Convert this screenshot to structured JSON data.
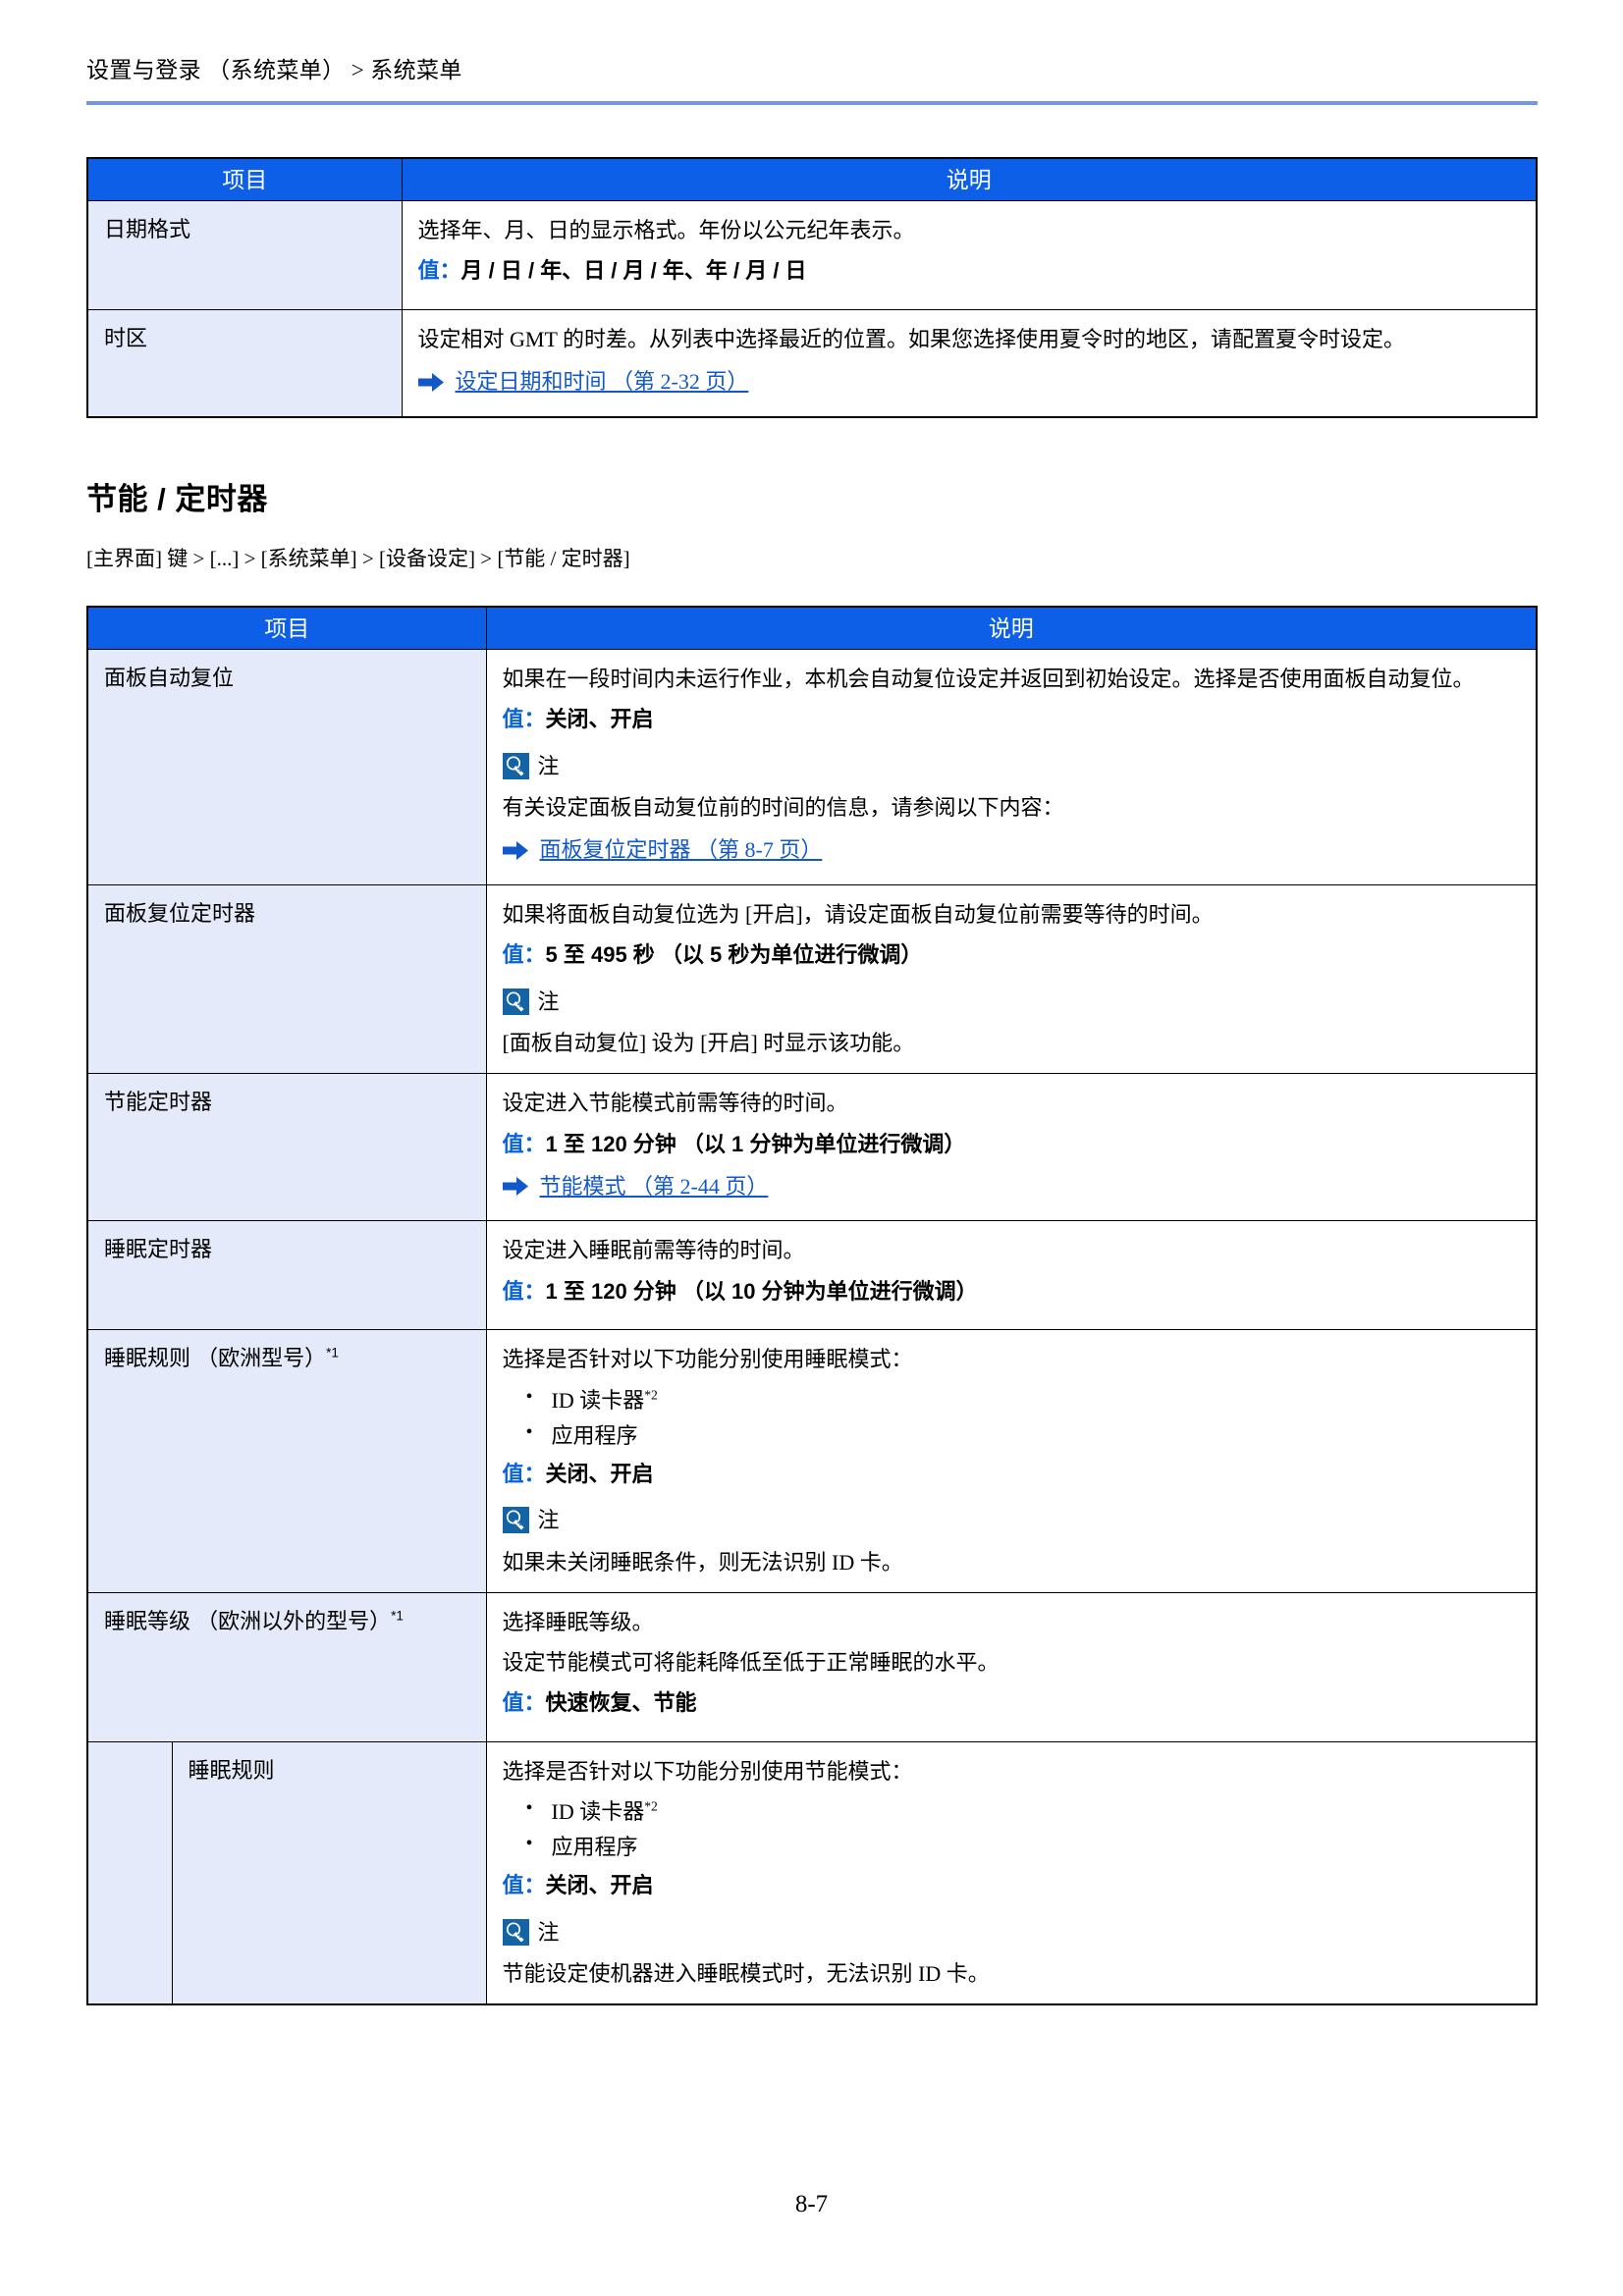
{
  "header": {
    "breadcrumb": "设置与登录 （系统菜单） > 系统菜单"
  },
  "footer": {
    "page_number": "8-7"
  },
  "table_date_time": {
    "columns": [
      "项目",
      "说明"
    ],
    "rows": [
      {
        "item": "日期格式",
        "desc_lines": [
          "选择年、月、日的显示格式。年份以公元纪年表示。"
        ],
        "value_key": "值：",
        "value_rest": "月 / 日 / 年、日 / 月 / 年、年 / 月 / 日"
      },
      {
        "item": "时区",
        "desc_lines": [
          "设定相对 GMT 的时差。从列表中选择最近的位置。如果您选择使用夏令时的地区，请配置夏令时设定。"
        ],
        "xref": "设定日期和时间 （第 2-32 页）"
      }
    ]
  },
  "section_energy": {
    "title": "节能 / 定时器",
    "path": "[主界面] 键 > [...] > [系统菜单] > [设备设定] > [节能 / 定时器]",
    "columns": [
      "项目",
      "说明"
    ],
    "rows": [
      {
        "item": "面板自动复位",
        "desc_lines": [
          "如果在一段时间内未运行作业，本机会自动复位设定并返回到初始设定。选择是否使用面板自动复位。"
        ],
        "value_key": "值：",
        "value_rest": "关闭、开启",
        "note_label": "注",
        "note_text": "有关设定面板自动复位前的时间的信息，请参阅以下内容：",
        "xref": "面板复位定时器 （第 8-7 页）"
      },
      {
        "item": "面板复位定时器",
        "desc_lines": [
          "如果将面板自动复位选为 [开启]，请设定面板自动复位前需要等待的时间。"
        ],
        "value_key": "值：",
        "value_rest": "5 至 495 秒 （以 5 秒为单位进行微调）",
        "note_label": "注",
        "note_text": "[面板自动复位] 设为 [开启] 时显示该功能。"
      },
      {
        "item": "节能定时器",
        "desc_lines": [
          "设定进入节能模式前需等待的时间。"
        ],
        "value_key": "值：",
        "value_rest": "1 至 120 分钟 （以 1 分钟为单位进行微调）",
        "xref": "节能模式 （第 2-44 页）"
      },
      {
        "item": "睡眠定时器",
        "desc_lines": [
          "设定进入睡眠前需等待的时间。"
        ],
        "value_key": "值：",
        "value_rest": "1 至 120 分钟 （以 10 分钟为单位进行微调）"
      },
      {
        "item": "睡眠规则 （欧洲型号）",
        "item_footnote": "*1",
        "desc_lines": [
          "选择是否针对以下功能分别使用睡眠模式："
        ],
        "bullets": [
          {
            "text": "ID 读卡器",
            "footnote": "*2"
          },
          {
            "text": "应用程序",
            "footnote": ""
          }
        ],
        "value_key": "值：",
        "value_rest": "关闭、开启",
        "note_label": "注",
        "note_text": "如果未关闭睡眠条件，则无法识别 ID 卡。"
      },
      {
        "item": "睡眠等级 （欧洲以外的型号）",
        "item_footnote": "*1",
        "desc_lines": [
          "选择睡眠等级。",
          "设定节能模式可将能耗降低至低于正常睡眠的水平。"
        ],
        "value_key": "值：",
        "value_rest": "快速恢复、节能"
      },
      {
        "item": "睡眠规则",
        "is_sub": true,
        "desc_lines": [
          "选择是否针对以下功能分别使用节能模式："
        ],
        "bullets": [
          {
            "text": "ID 读卡器",
            "footnote": "*2"
          },
          {
            "text": "应用程序",
            "footnote": ""
          }
        ],
        "value_key": "值：",
        "value_rest": "关闭、开启",
        "note_label": "注",
        "note_text": "节能设定使机器进入睡眠模式时，无法识别 ID 卡。"
      }
    ]
  },
  "colors": {
    "table_header_blue": "#0d5fe8",
    "item_cell_blue": "#e4eaf9",
    "value_key_blue": "#0a63d6",
    "link_blue": "#1358c8",
    "note_icon_blue": "#1464a5",
    "header_rule_blue": "#7796e0"
  }
}
